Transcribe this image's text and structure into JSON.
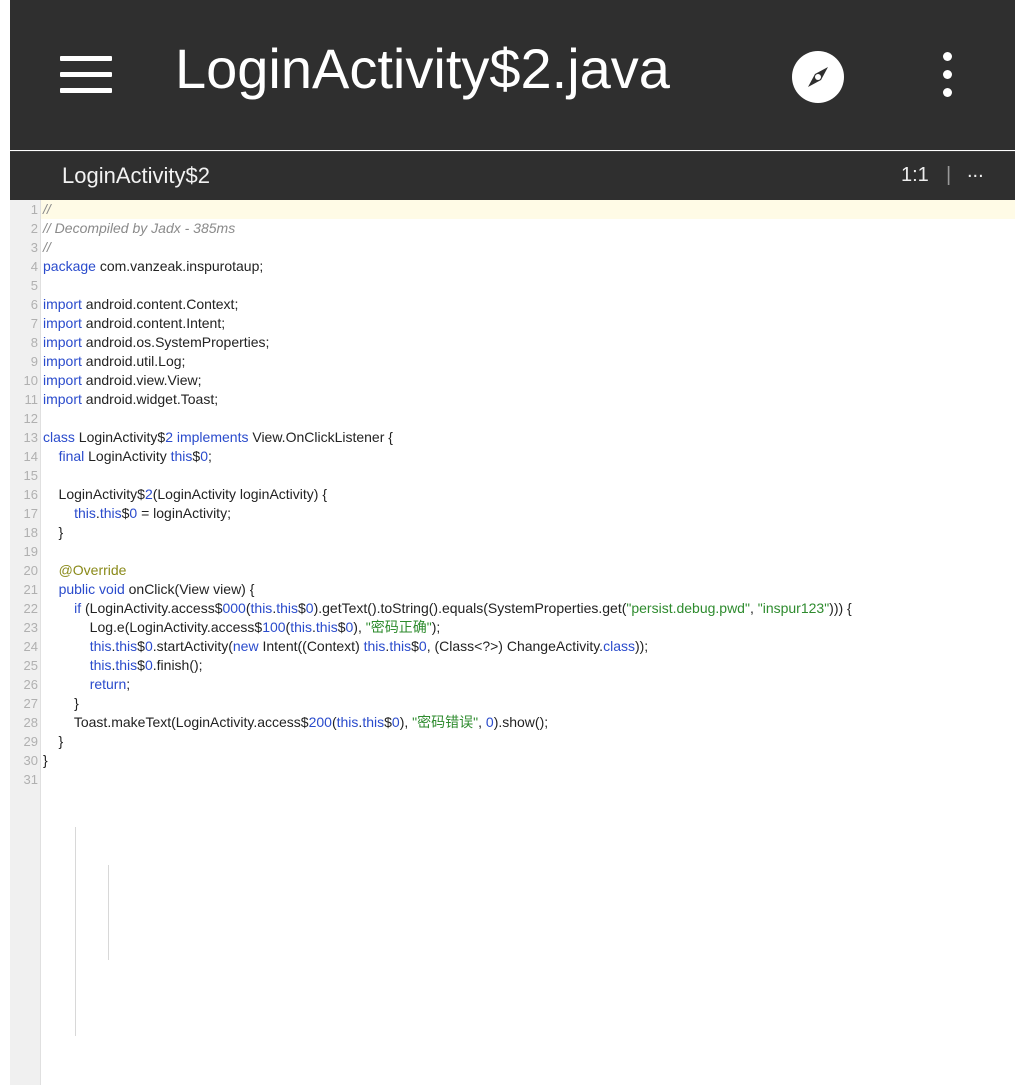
{
  "app_bar": {
    "title": "LoginActivity$2.java",
    "menu_icon": "hamburger-menu-icon",
    "compass_icon": "compass-icon",
    "more_icon": "more-vert-icon"
  },
  "sub_bar": {
    "class_name": "LoginActivity$2",
    "cursor_position": "1:1",
    "separator": "|",
    "more_label": "..."
  },
  "editor": {
    "lines": [
      {
        "n": "1",
        "t": "//"
      },
      {
        "n": "2",
        "t": "// Decompiled by Jadx - 385ms"
      },
      {
        "n": "3",
        "t": "//"
      },
      {
        "n": "4",
        "t": "package com.vanzeak.inspurotaup;"
      },
      {
        "n": "5",
        "t": ""
      },
      {
        "n": "6",
        "t": "import android.content.Context;"
      },
      {
        "n": "7",
        "t": "import android.content.Intent;"
      },
      {
        "n": "8",
        "t": "import android.os.SystemProperties;"
      },
      {
        "n": "9",
        "t": "import android.util.Log;"
      },
      {
        "n": "10",
        "t": "import android.view.View;"
      },
      {
        "n": "11",
        "t": "import android.widget.Toast;"
      },
      {
        "n": "12",
        "t": ""
      },
      {
        "n": "13",
        "t": "class LoginActivity$2 implements View.OnClickListener {"
      },
      {
        "n": "14",
        "t": "    final LoginActivity this$0;"
      },
      {
        "n": "15",
        "t": ""
      },
      {
        "n": "16",
        "t": "    LoginActivity$2(LoginActivity loginActivity) {"
      },
      {
        "n": "17",
        "t": "        this.this$0 = loginActivity;"
      },
      {
        "n": "18",
        "t": "    }"
      },
      {
        "n": "19",
        "t": ""
      },
      {
        "n": "20",
        "t": "    @Override"
      },
      {
        "n": "21",
        "t": "    public void onClick(View view) {"
      },
      {
        "n": "22",
        "t": "        if (LoginActivity.access$000(this.this$0).getText().toString().equals(SystemProperties.get(\"persist.debug.pwd\", \"inspur123\"))) {"
      },
      {
        "n": "23",
        "t": "            Log.e(LoginActivity.access$100(this.this$0), \"密码正确\");"
      },
      {
        "n": "24",
        "t": "            this.this$0.startActivity(new Intent((Context) this.this$0, (Class<?>) ChangeActivity.class));"
      },
      {
        "n": "25",
        "t": "            this.this$0.finish();"
      },
      {
        "n": "26",
        "t": "            return;"
      },
      {
        "n": "27",
        "t": "        }"
      },
      {
        "n": "28",
        "t": "        Toast.makeText(LoginActivity.access$200(this.this$0), \"密码错误\", 0).show();"
      },
      {
        "n": "29",
        "t": "    }"
      },
      {
        "n": "30",
        "t": "}"
      },
      {
        "n": "31",
        "t": ""
      }
    ]
  },
  "colors": {
    "app_bar_bg": "#2f2f2f",
    "keyword": "#2a4bcc",
    "string": "#2e8b2e",
    "comment": "#8a8a8a",
    "annotation": "#8a8a1a",
    "active_line": "#fffbe6"
  }
}
